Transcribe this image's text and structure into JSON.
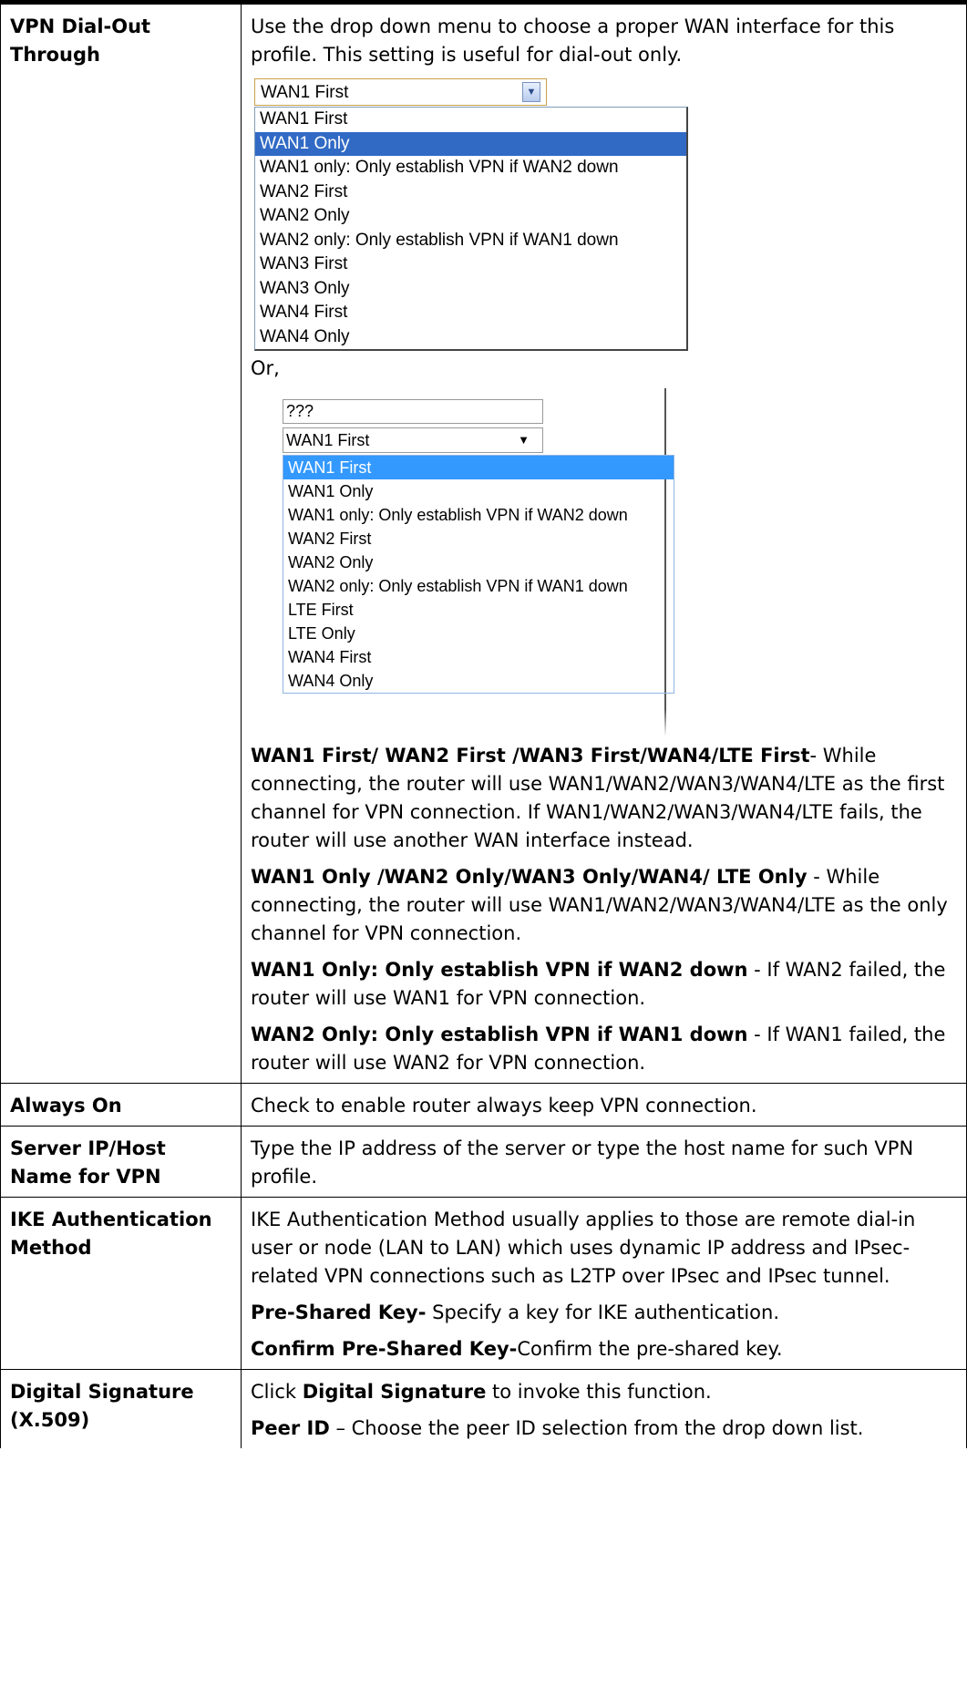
{
  "rows": {
    "vpn_dialout": {
      "label": "VPN Dial-Out Through",
      "intro": "Use the drop down menu to choose a proper WAN interface for this profile. This setting is useful for dial-out only.",
      "figure1": {
        "selected": "WAN1 First",
        "options": [
          "WAN1 First",
          "WAN1 Only",
          "WAN1 only: Only establish VPN if WAN2 down",
          "WAN2 First",
          "WAN2 Only",
          "WAN2 only: Only establish VPN if WAN1 down",
          "WAN3 First",
          "WAN3 Only",
          "WAN4 First",
          "WAN4 Only"
        ],
        "highlighted": "WAN1 Only"
      },
      "or_text": "Or,",
      "figure2": {
        "text_value": "???",
        "selected": "WAN1 First",
        "options": [
          "WAN1 First",
          "WAN1 Only",
          "WAN1 only: Only establish VPN if WAN2 down",
          "WAN2 First",
          "WAN2 Only",
          "WAN2 only: Only establish VPN if WAN1 down",
          "LTE First",
          "LTE Only",
          "WAN4 First",
          "WAN4 Only"
        ],
        "highlighted": "WAN1 First"
      },
      "p1_bold": "WAN1 First/ WAN2 First /WAN3 First/WAN4/LTE First",
      "p1_text": "- While connecting, the router will use WAN1/WAN2/WAN3/WAN4/LTE as the first channel for VPN connection. If WAN1/WAN2/WAN3/WAN4/LTE fails, the router will use another WAN interface instead.",
      "p2_bold": "WAN1 Only /WAN2 Only/WAN3 Only/WAN4/ LTE Only",
      "p2_text": " - While connecting, the router will use WAN1/WAN2/WAN3/WAN4/LTE as the only channel for VPN connection.",
      "p3_bold": "WAN1 Only: Only establish VPN if WAN2 down",
      "p3_text": " - If WAN2 failed, the router will use WAN1 for VPN connection.",
      "p4_bold": "WAN2 Only: Only establish VPN if WAN1 down",
      "p4_text": " - If WAN1 failed, the router will use WAN2 for VPN connection."
    },
    "always_on": {
      "label": "Always On",
      "text": "Check to enable router always keep VPN connection."
    },
    "server_ip": {
      "label": "Server IP/Host Name for VPN",
      "text": "Type the IP address of the server or type the host name for such VPN profile."
    },
    "ike_auth": {
      "label": "IKE Authentication Method",
      "text": "IKE Authentication Method usually applies to those are remote dial-in user or node (LAN to LAN) which uses dynamic IP address and IPsec-related VPN connections such as L2TP over IPsec and IPsec tunnel.",
      "psk_bold": "Pre-Shared Key-",
      "psk_text": " Specify a key for IKE authentication.",
      "cpsk_bold": "Confirm Pre-Shared Key-",
      "cpsk_text": "Confirm the pre-shared key."
    },
    "digital_sig": {
      "label": "Digital Signature (X.509)",
      "p1_pre": "Click ",
      "p1_bold": "Digital Signature",
      "p1_post": " to invoke this function.",
      "p2_bold": "Peer ID",
      "p2_text": " – Choose the peer ID selection from the drop down list."
    }
  }
}
